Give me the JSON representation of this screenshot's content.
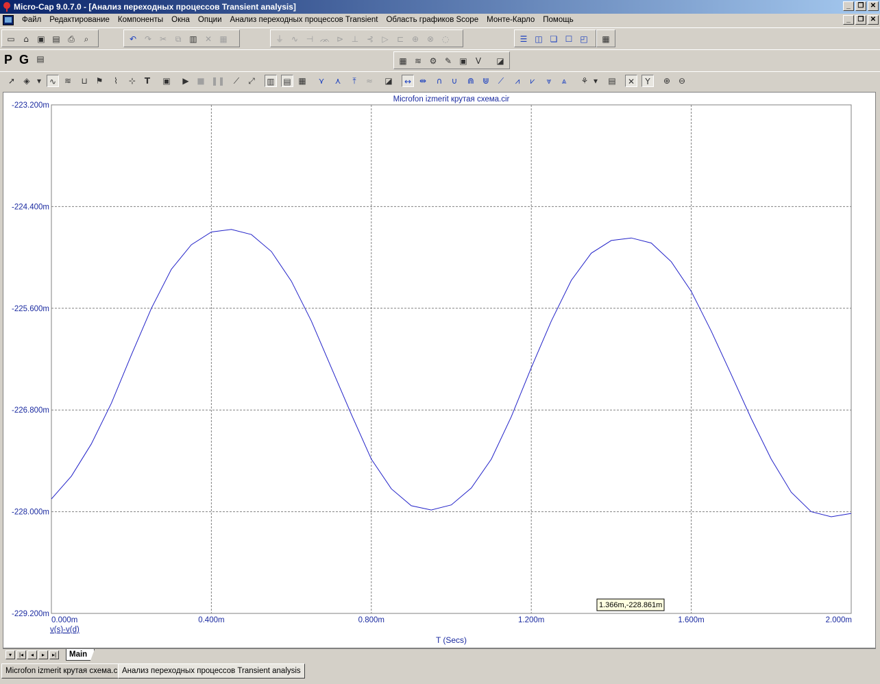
{
  "window": {
    "title": "Micro-Cap 9.0.7.0 - [Анализ переходных процессов Transient analysis]",
    "buttons": [
      "_",
      "❐",
      "✕"
    ]
  },
  "menu": {
    "items": [
      "Файл",
      "Редактирование",
      "Компоненты",
      "Окна",
      "Опции",
      "Анализ переходных процессов Transient",
      "Область графиков Scope",
      "Монте-Карло",
      "Помощь"
    ]
  },
  "toolbar2": {
    "p_label": "P",
    "g_label": "G"
  },
  "plot": {
    "title": "Microfon izmerit крутая схема.cir",
    "trace_color": "#2020c8",
    "text_color": "#1a2aa0",
    "cursor_readout": "1.366m,-228.861m",
    "expression_label": "v(s)-v(d)"
  },
  "chart_data": {
    "type": "line",
    "title": "Microfon izmerit крутая схема.cir",
    "xlabel": "T (Secs)",
    "ylabel": "",
    "xlim": [
      0,
      2.0
    ],
    "ylim": [
      -229.2,
      -223.2
    ],
    "x_unit": "ms",
    "y_unit": "mV",
    "x_ticks": [
      "0.000m",
      "0.400m",
      "0.800m",
      "1.200m",
      "1.600m",
      "2.000m"
    ],
    "y_ticks": [
      "-223.200m",
      "-224.400m",
      "-225.600m",
      "-226.800m",
      "-228.000m",
      "-229.200m"
    ],
    "grid": true,
    "series": [
      {
        "name": "v(s)-v(d)",
        "x": [
          0.0,
          0.05,
          0.1,
          0.15,
          0.2,
          0.25,
          0.3,
          0.35,
          0.4,
          0.45,
          0.5,
          0.55,
          0.6,
          0.65,
          0.7,
          0.75,
          0.8,
          0.85,
          0.9,
          0.95,
          1.0,
          1.05,
          1.1,
          1.15,
          1.2,
          1.25,
          1.3,
          1.35,
          1.4,
          1.45,
          1.5,
          1.55,
          1.6,
          1.65,
          1.7,
          1.75,
          1.8,
          1.85,
          1.9,
          1.95,
          2.0
        ],
        "y": [
          -227.85,
          -227.58,
          -227.2,
          -226.72,
          -226.15,
          -225.6,
          -225.14,
          -224.85,
          -224.7,
          -224.67,
          -224.73,
          -224.93,
          -225.28,
          -225.75,
          -226.3,
          -226.85,
          -227.38,
          -227.73,
          -227.93,
          -227.98,
          -227.92,
          -227.72,
          -227.38,
          -226.88,
          -226.3,
          -225.75,
          -225.27,
          -224.95,
          -224.8,
          -224.77,
          -224.83,
          -225.05,
          -225.4,
          -225.87,
          -226.38,
          -226.9,
          -227.38,
          -227.77,
          -228.0,
          -228.06,
          -228.02
        ]
      }
    ]
  }
}
